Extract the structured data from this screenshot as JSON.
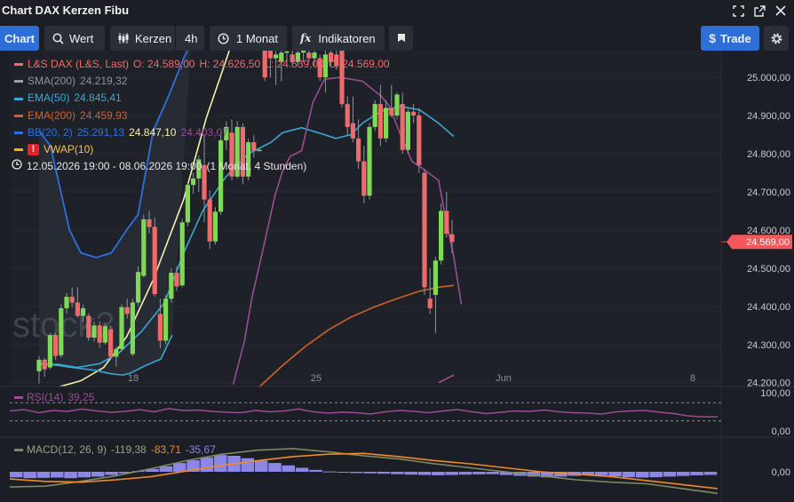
{
  "window": {
    "title": "Chart DAX Kerzen Fibu"
  },
  "icons": [
    "fullscreen-icon",
    "external-link-icon",
    "close-icon",
    "search-icon",
    "candlestick-icon",
    "clock-icon",
    "fx-icon",
    "flag-icon",
    "dollar-icon",
    "gear-icon",
    "warning-icon"
  ],
  "toolbar": {
    "chart_label": "Chart",
    "wert_label": "Wert",
    "kerzen_label": "Kerzen",
    "interval_label": "4h",
    "period_label": "1 Monat",
    "indicators_label": "Indikatoren",
    "trade_label": "Trade"
  },
  "legend": {
    "main": {
      "label": "L&S DAX (L&S, Last)",
      "open": "O: 24.589,00",
      "high": "H: 24.626,50",
      "low": "L: 24.539,00",
      "close": "C: 24.569,00"
    },
    "sma": {
      "label": "SMA(200)",
      "value": "24.219,32"
    },
    "ema50": {
      "label": "EMA(50)",
      "value": "24.845,41"
    },
    "ema200": {
      "label": "EMA(200)",
      "value": "24.459,93"
    },
    "bb": {
      "label": "BB(20, 2)",
      "upper": "25.291,13",
      "mid": "24.847,10",
      "lower": "24.403,07"
    },
    "vwap": {
      "label": "VWAP(10)"
    },
    "range": {
      "dates": "12.05.2026 19:00 - 08.06.2026 19:00",
      "desc": "(1 Monat, 4 Stunden)"
    },
    "rsi": {
      "label": "RSI(14)",
      "value": "39,25"
    },
    "macd": {
      "label": "MACD(12, 26, 9)",
      "macd": "-119,38",
      "signal": "-83,71",
      "hist": "-35,67"
    }
  },
  "watermark": "stock3",
  "colors": {
    "up": "#7ed957",
    "down": "#ef6b6b",
    "sma": "#f5f0b0",
    "ema50": "#3ba7d4",
    "ema200": "#d2602a",
    "bb": "#2f6fe0",
    "vwap": "#9a4c94",
    "price_tag": "#f2585b",
    "macd_line": "#7d8c5e",
    "macd_signal": "#f08a24",
    "histogram": "#8c86e6",
    "accent": "#2d6fd6"
  },
  "chart_data": {
    "type": "candlestick",
    "y_axis": {
      "ticks": [
        25000,
        24900,
        24800,
        24700,
        24600,
        24500,
        24400,
        24300,
        24200
      ],
      "tick_labels": [
        "25.000,00",
        "24.900,00",
        "24.800,00",
        "24.700,00",
        "24.600,00",
        "24.500,00",
        "24.400,00",
        "24.300,00",
        "24.200,00"
      ],
      "ylim": [
        24190,
        25070
      ]
    },
    "x_axis": {
      "tick_labels": [
        "18",
        "25",
        "Jun",
        "8"
      ]
    },
    "last_price": {
      "value": 24569,
      "label": "24.569,00"
    },
    "candles": [
      [
        24230,
        24270,
        24198,
        24260
      ],
      [
        24260,
        24265,
        24215,
        24235
      ],
      [
        24240,
        24330,
        24235,
        24325
      ],
      [
        24325,
        24330,
        24260,
        24270
      ],
      [
        24272,
        24405,
        24265,
        24395
      ],
      [
        24395,
        24435,
        24380,
        24425
      ],
      [
        24425,
        24450,
        24398,
        24410
      ],
      [
        24410,
        24450,
        24370,
        24375
      ],
      [
        24375,
        24405,
        24360,
        24395
      ],
      [
        24375,
        24382,
        24310,
        24318
      ],
      [
        24318,
        24360,
        24308,
        24350
      ],
      [
        24350,
        24360,
        24292,
        24305
      ],
      [
        24305,
        24355,
        24300,
        24348
      ],
      [
        24340,
        24348,
        24262,
        24268
      ],
      [
        24268,
        24295,
        24242,
        24288
      ],
      [
        24288,
        24405,
        24282,
        24398
      ],
      [
        24398,
        24420,
        24368,
        24380
      ],
      [
        24275,
        24420,
        24270,
        24410
      ],
      [
        24410,
        24505,
        24400,
        24490
      ],
      [
        24480,
        24640,
        24475,
        24628
      ],
      [
        24628,
        24650,
        24592,
        24608
      ],
      [
        24608,
        24632,
        24425,
        24432
      ],
      [
        24380,
        24420,
        24290,
        24310
      ],
      [
        24310,
        24430,
        24300,
        24420
      ],
      [
        24420,
        24500,
        24410,
        24488
      ],
      [
        24488,
        24505,
        24440,
        24452
      ],
      [
        24455,
        24630,
        24450,
        24620
      ],
      [
        24620,
        24725,
        24610,
        24718
      ],
      [
        24718,
        24750,
        24695,
        24735
      ],
      [
        24735,
        24795,
        24700,
        24785
      ],
      [
        24770,
        24850,
        24620,
        24680
      ],
      [
        24680,
        24705,
        24550,
        24570
      ],
      [
        24570,
        24660,
        24562,
        24648
      ],
      [
        24648,
        24855,
        24640,
        24835
      ],
      [
        24835,
        24885,
        24810,
        24870
      ],
      [
        24855,
        24890,
        24730,
        24740
      ],
      [
        24740,
        24885,
        24735,
        24870
      ],
      [
        24870,
        24880,
        24720,
        24740
      ],
      [
        24740,
        24840,
        24730,
        24830
      ],
      [
        24830,
        24848,
        24790,
        24808
      ],
      [
        24808,
        24812,
        24808,
        24810
      ],
      [
        25070,
        25070,
        24990,
        25000
      ],
      [
        25070,
        25070,
        25000,
        25050
      ],
      [
        25050,
        25070,
        24980,
        25060
      ],
      [
        25040,
        25070,
        24990,
        25065
      ],
      [
        25065,
        25070,
        25040,
        25068
      ],
      [
        25060,
        25070,
        25030,
        25040
      ],
      [
        25040,
        25070,
        25030,
        25065
      ],
      [
        25065,
        25070,
        25040,
        25070
      ],
      [
        25065,
        25070,
        25040,
        25050
      ],
      [
        25050,
        25070,
        25030,
        25065
      ],
      [
        25050,
        25060,
        24990,
        25000
      ],
      [
        25000,
        25070,
        24960,
        25060
      ],
      [
        25065,
        25070,
        25030,
        25040
      ],
      [
        25060,
        25070,
        25020,
        25030
      ],
      [
        25070,
        25070,
        24920,
        24930
      ],
      [
        24930,
        24950,
        24850,
        24870
      ],
      [
        24880,
        24950,
        24830,
        24840
      ],
      [
        24840,
        24890,
        24760,
        24780
      ],
      [
        24780,
        24820,
        24670,
        24690
      ],
      [
        24690,
        24880,
        24680,
        24870
      ],
      [
        24870,
        24940,
        24860,
        24930
      ],
      [
        24930,
        24980,
        24820,
        24840
      ],
      [
        24840,
        24940,
        24830,
        24920
      ],
      [
        24920,
        24980,
        24895,
        24900
      ],
      [
        24900,
        24960,
        24890,
        24955
      ],
      [
        24930,
        24960,
        24800,
        24810
      ],
      [
        24810,
        24920,
        24800,
        24910
      ],
      [
        24910,
        24930,
        24880,
        24900
      ],
      [
        24900,
        24920,
        24750,
        24770
      ],
      [
        24750,
        24760,
        24430,
        24450
      ],
      [
        24420,
        24500,
        24380,
        24395
      ],
      [
        24430,
        24530,
        24330,
        24520
      ],
      [
        24520,
        24670,
        24510,
        24650
      ],
      [
        24650,
        24700,
        24580,
        24590
      ],
      [
        24589,
        24626.5,
        24539,
        24569
      ]
    ],
    "indicators": {
      "sma200": [
        [
          0,
          24140
        ],
        [
          3,
          24183
        ],
        [
          11,
          24205
        ],
        [
          17,
          24240
        ],
        [
          23,
          24320
        ],
        [
          30,
          24470
        ],
        [
          38,
          24680
        ],
        [
          44,
          24895
        ],
        [
          50,
          25070
        ]
      ],
      "ema50": [
        [
          0,
          24248
        ],
        [
          5,
          24248
        ],
        [
          10,
          24240
        ],
        [
          16,
          24250
        ],
        [
          21,
          24278
        ],
        [
          27,
          24335
        ],
        [
          33,
          24410
        ],
        [
          38,
          24540
        ],
        [
          43,
          24650
        ],
        [
          49,
          24738
        ],
        [
          55,
          24800
        ],
        [
          61,
          24830
        ],
        [
          64,
          24855
        ],
        [
          69,
          24868
        ],
        [
          75,
          24850
        ],
        [
          78,
          24840
        ],
        [
          82,
          24850
        ],
        [
          85,
          24880
        ],
        [
          90,
          24912
        ],
        [
          95,
          24924
        ],
        [
          100,
          24915
        ],
        [
          105,
          24880
        ],
        [
          109,
          24845
        ]
      ],
      "ema200": [
        [
          0,
          23905
        ],
        [
          10,
          23930
        ],
        [
          20,
          23960
        ],
        [
          30,
          23990
        ],
        [
          40,
          24015
        ],
        [
          46,
          24070
        ],
        [
          52,
          24125
        ],
        [
          58,
          24190
        ],
        [
          64,
          24245
        ],
        [
          70,
          24295
        ],
        [
          76,
          24338
        ],
        [
          82,
          24372
        ],
        [
          88,
          24398
        ],
        [
          94,
          24420
        ],
        [
          100,
          24440
        ],
        [
          105,
          24450
        ],
        [
          109,
          24455
        ]
      ],
      "bb_upper": [
        [
          0,
          24860
        ],
        [
          3,
          24820
        ],
        [
          8,
          24600
        ],
        [
          11,
          24540
        ],
        [
          15,
          24528
        ],
        [
          19,
          24540
        ],
        [
          23,
          24600
        ],
        [
          26,
          24640
        ],
        [
          30,
          24860
        ],
        [
          34,
          24950
        ],
        [
          38,
          25050
        ],
        [
          40,
          25090
        ]
      ],
      "bb_lower": [
        [
          0,
          24250
        ],
        [
          5,
          24245
        ],
        [
          10,
          24238
        ],
        [
          15,
          24232
        ],
        [
          18,
          24225
        ],
        [
          20,
          24222
        ],
        [
          22,
          24220
        ],
        [
          24,
          24225
        ],
        [
          28,
          24245
        ],
        [
          32,
          24262
        ],
        [
          35,
          24325
        ]
      ],
      "vwap": [
        [
          51,
          24195
        ],
        [
          54,
          24310
        ],
        [
          56,
          24425
        ],
        [
          59,
          24555
        ],
        [
          62,
          24690
        ],
        [
          64,
          24755
        ],
        [
          66,
          24793
        ],
        [
          69,
          24808
        ],
        [
          72,
          24935
        ],
        [
          75,
          24995
        ],
        [
          79,
          25000
        ],
        [
          85,
          24990
        ],
        [
          90,
          24950
        ],
        [
          92,
          24925
        ],
        [
          95,
          24850
        ],
        [
          98,
          24780
        ],
        [
          101,
          24760
        ],
        [
          105,
          24730
        ],
        [
          107,
          24625
        ],
        [
          109,
          24530
        ],
        [
          111,
          24405
        ]
      ],
      "lower_right": [
        [
          105,
          24200
        ],
        [
          109,
          24220
        ]
      ]
    },
    "rsi": {
      "ylim": [
        0,
        100
      ],
      "ticks": [
        100,
        0
      ],
      "tick_labels": [
        "100,00",
        "0,00"
      ],
      "levels": [
        70,
        30
      ],
      "values": [
        52,
        55,
        48,
        53,
        51,
        56,
        52,
        49,
        51,
        55,
        50,
        57,
        53,
        54,
        51,
        49,
        48,
        53,
        50,
        52,
        56,
        50,
        47,
        49,
        48,
        45,
        50,
        53,
        51,
        48,
        52,
        55,
        50,
        46,
        49,
        52,
        51,
        54,
        50,
        48,
        47,
        45,
        50,
        52,
        53,
        49,
        46,
        41,
        39,
        39
      ]
    },
    "macd": {
      "tick_labels": [
        "0,00"
      ],
      "histogram": [
        -0.35,
        -0.4,
        -0.38,
        -0.36,
        -0.4,
        -0.35,
        -0.3,
        -0.2,
        -0.1,
        0.05,
        0.18,
        0.35,
        0.55,
        0.72,
        0.9,
        1.05,
        1.0,
        0.85,
        0.7,
        0.55,
        0.4,
        0.25,
        0.12,
        0.02,
        -0.05,
        -0.08,
        -0.1,
        -0.12,
        -0.15,
        -0.18,
        -0.2,
        -0.22,
        -0.2,
        -0.18,
        -0.16,
        -0.15,
        -0.2,
        -0.25,
        -0.3,
        -0.35,
        -0.3,
        -0.25,
        -0.2,
        -0.22,
        -0.28,
        -0.34,
        -0.36,
        -0.34,
        -0.3,
        -0.26,
        -0.22,
        -0.2
      ],
      "macd_line": [
        -0.95,
        -0.9,
        -0.6,
        -0.25,
        0.2,
        0.7,
        1.1,
        1.35,
        1.45,
        1.25,
        1.0,
        0.8,
        0.5,
        0.25,
        0.0,
        -0.25,
        -0.5,
        -0.65,
        -0.75,
        -1.05,
        -1.35
      ],
      "signal_line": [
        -0.45,
        -0.6,
        -0.65,
        -0.5,
        -0.3,
        0.05,
        0.4,
        0.7,
        0.95,
        1.1,
        1.15,
        0.95,
        0.7,
        0.5,
        0.25,
        0.0,
        -0.15,
        -0.3,
        -0.55,
        -0.8,
        -1.05
      ]
    }
  }
}
